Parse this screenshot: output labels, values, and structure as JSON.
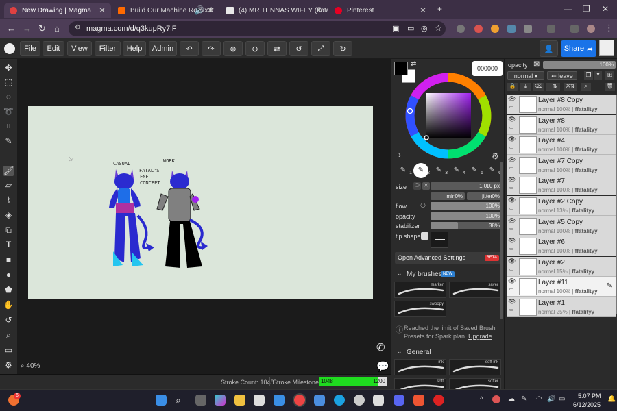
{
  "browser": {
    "tabs": [
      {
        "title": "New Drawing | Magma",
        "color": "#e04141"
      },
      {
        "title": "Build Our Machine Remix ft",
        "color": "#ff6a00"
      },
      {
        "title": "(4) MR TENNAS WIFEY (ffatality",
        "color": "#e8e8e8"
      },
      {
        "title": "Pinterest",
        "color": "#e60023"
      }
    ],
    "url": "magma.com/d/q3kupRy7iF"
  },
  "menu": {
    "file": "File",
    "edit": "Edit",
    "view": "View",
    "filter": "Filter",
    "help": "Help",
    "admin": "Admin",
    "share": "Share"
  },
  "artwork": {
    "label1": "CASUAL",
    "label2": "WORK",
    "label3": "FATAL'S",
    "label4": "FNF",
    "label5": "CONCEPT"
  },
  "status": {
    "zoom": "40%",
    "stroke_count": "Stroke Count: 1048",
    "milestone_label": "Stroke Milestone:",
    "milestone_value": "1048",
    "milestone_max": "1200",
    "milestone_progress": 0.873
  },
  "color": {
    "hex": "000000",
    "primary": "#000000",
    "secondary": "#ffffff"
  },
  "brush": {
    "slots": [
      "1",
      "2",
      "3",
      "4",
      "5",
      "6"
    ],
    "size_label": "size",
    "size_min": "1.0",
    "size_value": "10 px",
    "min_label": "min",
    "min_value": "0%",
    "jitter_label": "jitter",
    "jitter_value": "0%",
    "flow_label": "flow",
    "flow_value": "100%",
    "opacity_label": "opacity",
    "opacity_value": "100%",
    "stabilizer_label": "stabilizer",
    "stabilizer_value": "38%",
    "stabilizer_fraction": 0.38,
    "tip_label": "tip shape",
    "advanced": "Open Advanced Settings",
    "beta": "BETA",
    "my_brushes": "My brushes",
    "new_badge": "NEW",
    "presets": [
      "marker",
      "saver",
      "swoopy"
    ],
    "limit_text": "Reached the limit of Saved Brush Presets for Spark plan.",
    "upgrade": "Upgrade",
    "general": "General",
    "general_presets": [
      "ink",
      "soft ink",
      "soft",
      "softer"
    ]
  },
  "layers": {
    "opacity_label": "opacity",
    "opacity_value": "100%",
    "blend": "normal",
    "leave": "leave",
    "items": [
      {
        "name": "Layer #8 Copy",
        "meta": "normal 100%",
        "owner": "ffatalityy",
        "selected": false
      },
      {
        "name": "Layer #8",
        "meta": "normal 100%",
        "owner": "ffatalityy",
        "selected": false
      },
      {
        "name": "Layer #4",
        "meta": "normal 100%",
        "owner": "ffatalityy",
        "selected": false
      },
      {
        "name": "Layer #7 Copy",
        "meta": "normal 100%",
        "owner": "ffatalityy",
        "selected": false
      },
      {
        "name": "Layer #7",
        "meta": "normal 100%",
        "owner": "ffatalityy",
        "selected": false
      },
      {
        "name": "Layer #2 Copy",
        "meta": "normal 13%",
        "owner": "ffatalityy",
        "selected": false
      },
      {
        "name": "Layer #5 Copy",
        "meta": "normal 100%",
        "owner": "ffatalityy",
        "selected": false
      },
      {
        "name": "Layer #6",
        "meta": "normal 100%",
        "owner": "ffatalityy",
        "selected": false
      },
      {
        "name": "Layer #2",
        "meta": "normal 15%",
        "owner": "ffatalityy",
        "selected": false
      },
      {
        "name": "Layer #11",
        "meta": "normal 100%",
        "owner": "ffatalityy",
        "selected": true
      },
      {
        "name": "Layer #1",
        "meta": "normal 25%",
        "owner": "ffatalityy",
        "selected": false
      }
    ]
  },
  "taskbar": {
    "badge": "6",
    "time": "5:07 PM",
    "date": "6/12/2025"
  }
}
